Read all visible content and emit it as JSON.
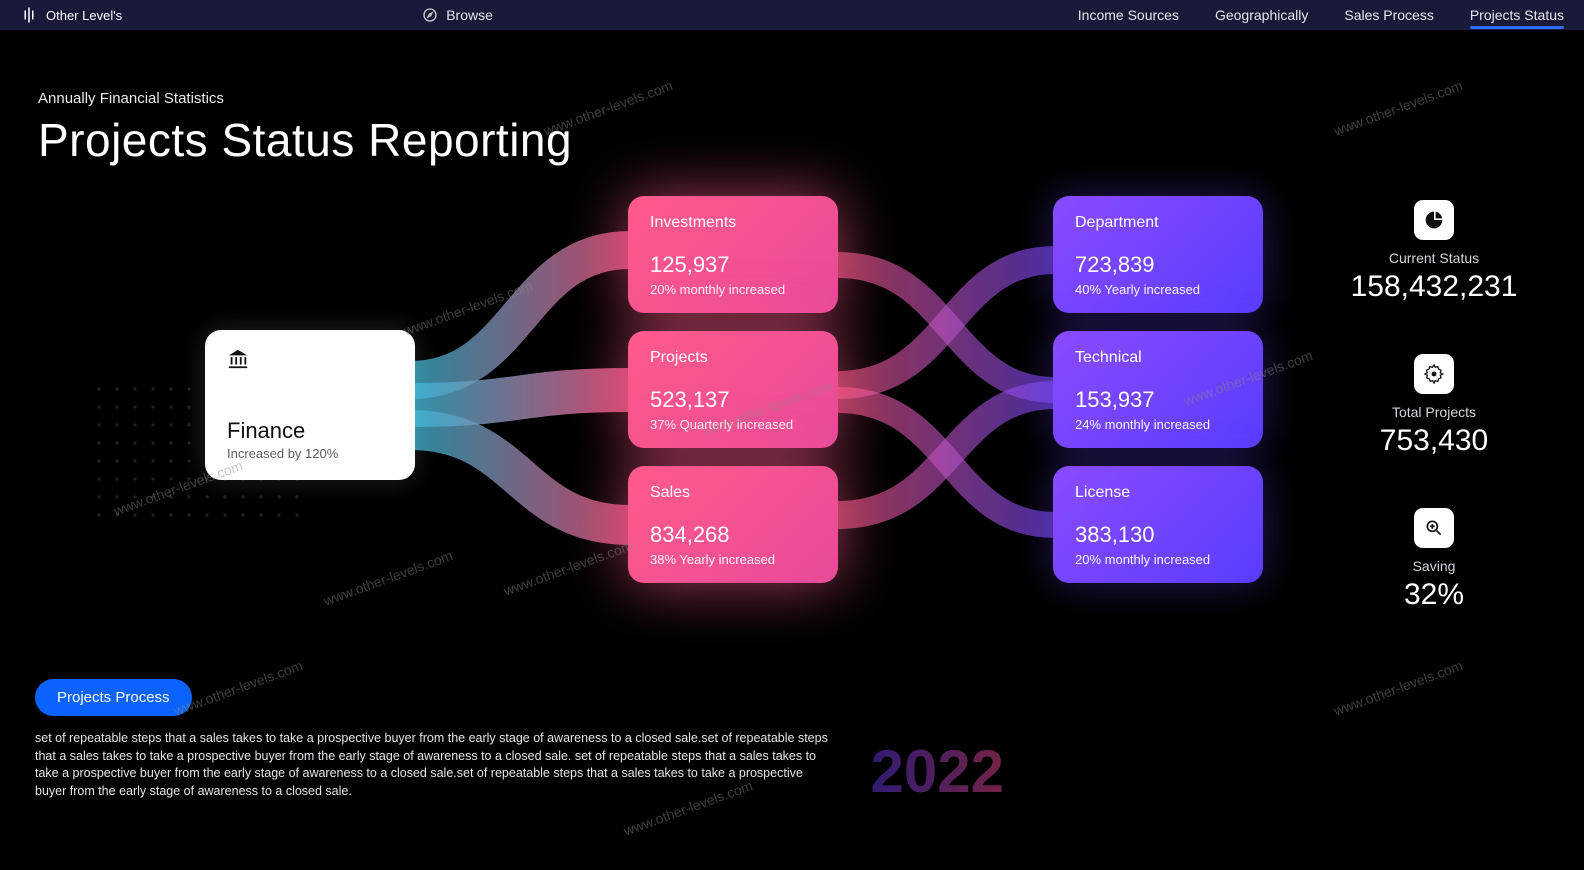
{
  "header": {
    "brand": "Other Level's",
    "browse": "Browse",
    "nav": [
      "Income Sources",
      "Geographically",
      "Sales Process",
      "Projects Status"
    ],
    "active_index": 3
  },
  "title": {
    "eyebrow": "Annually Financial Statistics",
    "main": "Projects Status Reporting"
  },
  "source": {
    "name": "Finance",
    "sub": "Increased by 120%"
  },
  "mid_nodes": [
    {
      "name": "Investments",
      "value": "125,937",
      "sub": "20% monthly increased"
    },
    {
      "name": "Projects",
      "value": "523,137",
      "sub": "37% Quarterly increased"
    },
    {
      "name": "Sales",
      "value": "834,268",
      "sub": "38% Yearly increased"
    }
  ],
  "right_nodes": [
    {
      "name": "Department",
      "value": "723,839",
      "sub": "40% Yearly increased"
    },
    {
      "name": "Technical",
      "value": "153,937",
      "sub": "24% monthly increased"
    },
    {
      "name": "License",
      "value": "383,130",
      "sub": "20% monthly increased"
    }
  ],
  "stats": [
    {
      "label": "Current Status",
      "value": "158,432,231"
    },
    {
      "label": "Total Projects",
      "value": "753,430"
    },
    {
      "label": "Saving",
      "value": "32%"
    }
  ],
  "footer": {
    "button": "Projects Process",
    "desc": "set of repeatable steps that a sales takes to take a prospective buyer from the early stage of awareness to a closed sale.set of repeatable steps that a sales takes to take a prospective buyer from the early stage of awareness to a closed sale. set of repeatable steps that a sales takes to take a prospective buyer from the early stage of awareness to a closed sale.set of repeatable steps that a sales takes to take a prospective buyer from the early stage of awareness to a closed sale.",
    "year": "2022"
  },
  "watermark": "www.other-levels.com",
  "chart_data": {
    "type": "sankey",
    "title": "Projects Status Reporting",
    "nodes": [
      {
        "id": "Finance",
        "level": 0
      },
      {
        "id": "Investments",
        "level": 1,
        "value": 125937
      },
      {
        "id": "Projects",
        "level": 1,
        "value": 523137
      },
      {
        "id": "Sales",
        "level": 1,
        "value": 834268
      },
      {
        "id": "Department",
        "level": 2,
        "value": 723839
      },
      {
        "id": "Technical",
        "level": 2,
        "value": 153937
      },
      {
        "id": "License",
        "level": 2,
        "value": 383130
      }
    ],
    "links": [
      {
        "source": "Finance",
        "target": "Investments"
      },
      {
        "source": "Finance",
        "target": "Projects"
      },
      {
        "source": "Finance",
        "target": "Sales"
      },
      {
        "source": "Investments",
        "target": "Department"
      },
      {
        "source": "Investments",
        "target": "Technical"
      },
      {
        "source": "Projects",
        "target": "Department"
      },
      {
        "source": "Projects",
        "target": "License"
      },
      {
        "source": "Sales",
        "target": "Technical"
      },
      {
        "source": "Sales",
        "target": "License"
      }
    ],
    "summary": {
      "current_status": 158432231,
      "total_projects": 753430,
      "saving_pct": 32
    }
  }
}
